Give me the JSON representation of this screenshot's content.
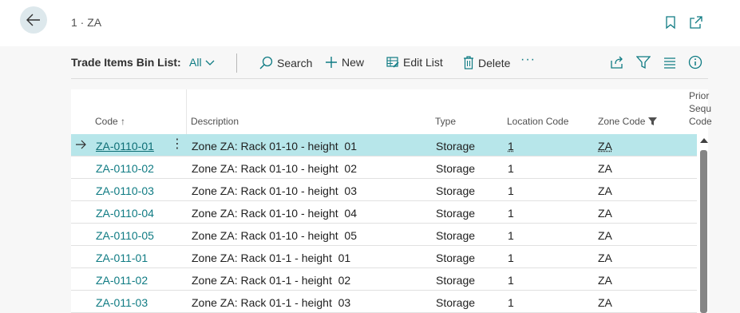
{
  "header": {
    "breadcrumb": "1 · ZA"
  },
  "toolbar": {
    "title": "Trade Items Bin List:",
    "filter_label": "All",
    "search_label": "Search",
    "new_label": "New",
    "edit_list_label": "Edit List",
    "delete_label": "Delete",
    "more_label": "···"
  },
  "columns": {
    "code": "Code ↑",
    "description": "Description",
    "type": "Type",
    "location_code": "Location Code",
    "zone_code": "Zone Code",
    "priority_line1": "Prior",
    "priority_line2": "Sequ",
    "priority_line3": "Code"
  },
  "rows": [
    {
      "code": "ZA-0110-01",
      "description": "Zone ZA: Rack 01-10 - height  01",
      "type": "Storage",
      "location": "1",
      "zone": "ZA"
    },
    {
      "code": "ZA-0110-02",
      "description": "Zone ZA: Rack 01-10 - height  02",
      "type": "Storage",
      "location": "1",
      "zone": "ZA"
    },
    {
      "code": "ZA-0110-03",
      "description": "Zone ZA: Rack 01-10 - height  03",
      "type": "Storage",
      "location": "1",
      "zone": "ZA"
    },
    {
      "code": "ZA-0110-04",
      "description": "Zone ZA: Rack 01-10 - height  04",
      "type": "Storage",
      "location": "1",
      "zone": "ZA"
    },
    {
      "code": "ZA-0110-05",
      "description": "Zone ZA: Rack 01-10 - height  05",
      "type": "Storage",
      "location": "1",
      "zone": "ZA"
    },
    {
      "code": "ZA-011-01",
      "description": "Zone ZA: Rack 01-1 - height  01",
      "type": "Storage",
      "location": "1",
      "zone": "ZA"
    },
    {
      "code": "ZA-011-02",
      "description": "Zone ZA: Rack 01-1 - height  02",
      "type": "Storage",
      "location": "1",
      "zone": "ZA"
    },
    {
      "code": "ZA-011-03",
      "description": "Zone ZA: Rack 01-1 - height  03",
      "type": "Storage",
      "location": "1",
      "zone": "ZA"
    }
  ],
  "colors": {
    "accent": "#0f7b83",
    "selected_row": "#b7e6ea",
    "back_button_bg": "#dde8ec"
  }
}
